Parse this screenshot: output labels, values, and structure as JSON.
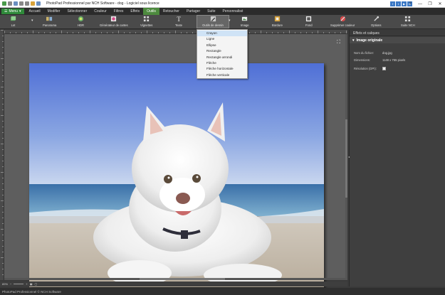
{
  "title": "PhotoPad Professionnel par NCH Software - dog - Logiciel sous licence",
  "window_controls": [
    "?",
    "—",
    "❐",
    "✕"
  ],
  "menu_button": "Menu",
  "tabs": [
    "Accueil",
    "Modifier",
    "Sélectionner",
    "Couleur",
    "Filtres",
    "Effets",
    "Outils",
    "Retoucher",
    "Partager",
    "Suite",
    "Personnalisé"
  ],
  "active_tab": "Outils",
  "ribbon": {
    "lot": "Lot",
    "panorama": "Panorama",
    "hdr": "HDR",
    "generateur": "Générateur de cartes",
    "vignettes": "Vignettes",
    "texte": "Texte",
    "outils_dessin": "Outils de dessin",
    "image": "Image",
    "bordure": "Bordure",
    "fond": "Fond",
    "supprimer": "Supprimer couleur",
    "options": "Options",
    "suite": "Suite NCH"
  },
  "dropdown_items": [
    "Crayon",
    "Ligne",
    "Ellipse",
    "Rectangle",
    "Rectangle arrondi",
    "Flèche",
    "Flèche horizontale",
    "Flèche verticale"
  ],
  "dropdown_selected": "Crayon",
  "zoom": "89%",
  "status": "PhotoPad Professionnel © NCH Software",
  "panel": {
    "title": "Effets et calques",
    "section": "Image originale",
    "props": [
      {
        "label": "Nom du fichier:",
        "value": "dog.jpg"
      },
      {
        "label": "Dimensions:",
        "value": "1148 x 755 pixels"
      },
      {
        "label": "Résolution (DPI):",
        "value": ""
      }
    ]
  },
  "colors": {
    "accent": "#4d8a3e",
    "menu": "#2f8a3a",
    "dropdown_highlight": "#cfe3f6"
  }
}
